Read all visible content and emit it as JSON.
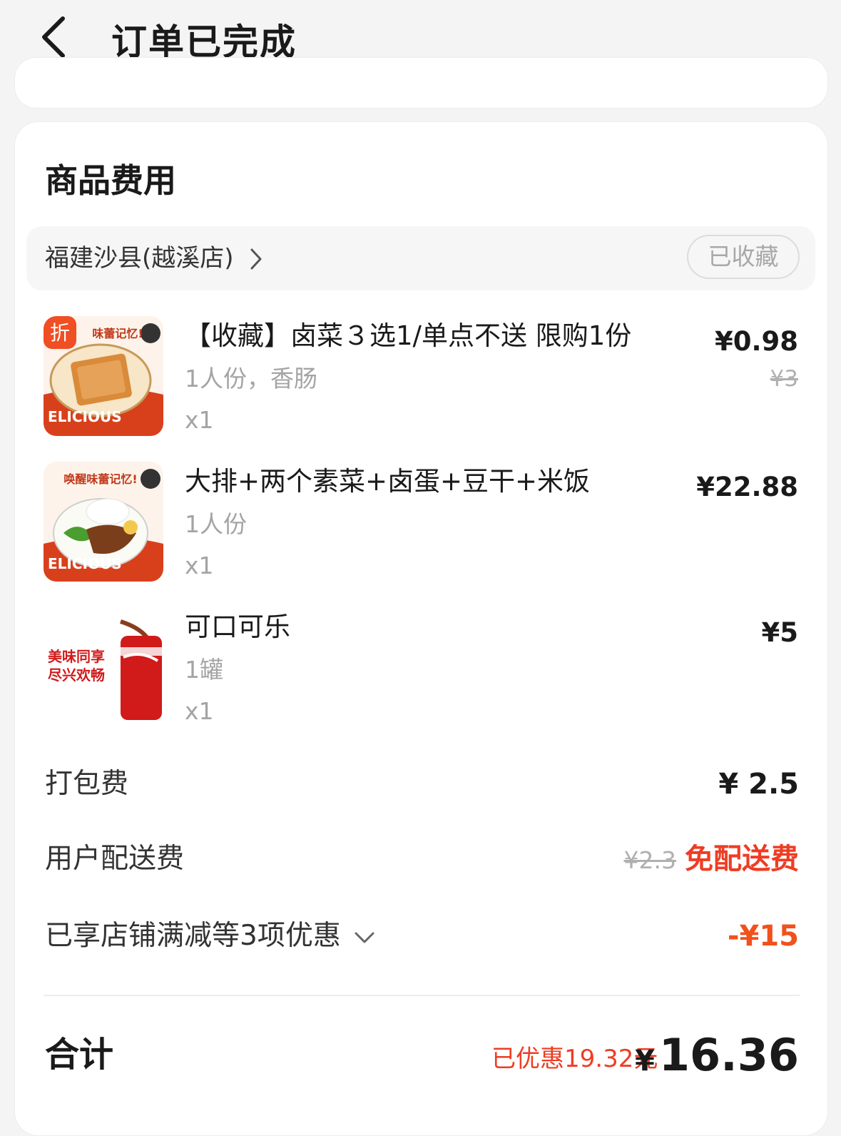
{
  "header": {
    "title": "订单已完成",
    "back_icon": "chevron-left-icon"
  },
  "section": {
    "title": "商品费用"
  },
  "store": {
    "name": "福建沙县(越溪店)",
    "favorite_label": "已收藏",
    "chevron_icon": "chevron-right-icon"
  },
  "items": [
    {
      "name": "【收藏】卤菜３选1/单点不送 限购1份",
      "spec": "1人份，香肠",
      "qty": "x1",
      "price": "¥0.98",
      "original_price": "¥3",
      "badge": "折",
      "thumb_caption_top": "味蕾记忆!",
      "thumb_caption_bottom": "ELICIOUS"
    },
    {
      "name": "大排+两个素菜+卤蛋+豆干+米饭",
      "spec": "1人份",
      "qty": "x1",
      "price": "¥22.88",
      "thumb_caption_top": "唤醒味蕾记忆!",
      "thumb_caption_bottom": "ELICIOUS"
    },
    {
      "name": "可口可乐",
      "spec": "1罐",
      "qty": "x1",
      "price": "¥5",
      "thumb_caption_top": "美味同享",
      "thumb_caption_bottom": "尽兴欢畅"
    }
  ],
  "fees": {
    "packing_label": "打包费",
    "packing_value": "¥ 2.5",
    "delivery_label": "用户配送费",
    "delivery_original": "¥2.3",
    "delivery_value": "免配送费",
    "discount_label": "已享店铺满减等3项优惠",
    "discount_value": "-¥15"
  },
  "total": {
    "label": "合计",
    "saved": "已优惠19.32元",
    "currency": "¥",
    "amount": "16.36"
  },
  "colors": {
    "accent_red": "#ee3d24",
    "badge_orange": "#f04e23",
    "background": "#f4f4f4"
  }
}
